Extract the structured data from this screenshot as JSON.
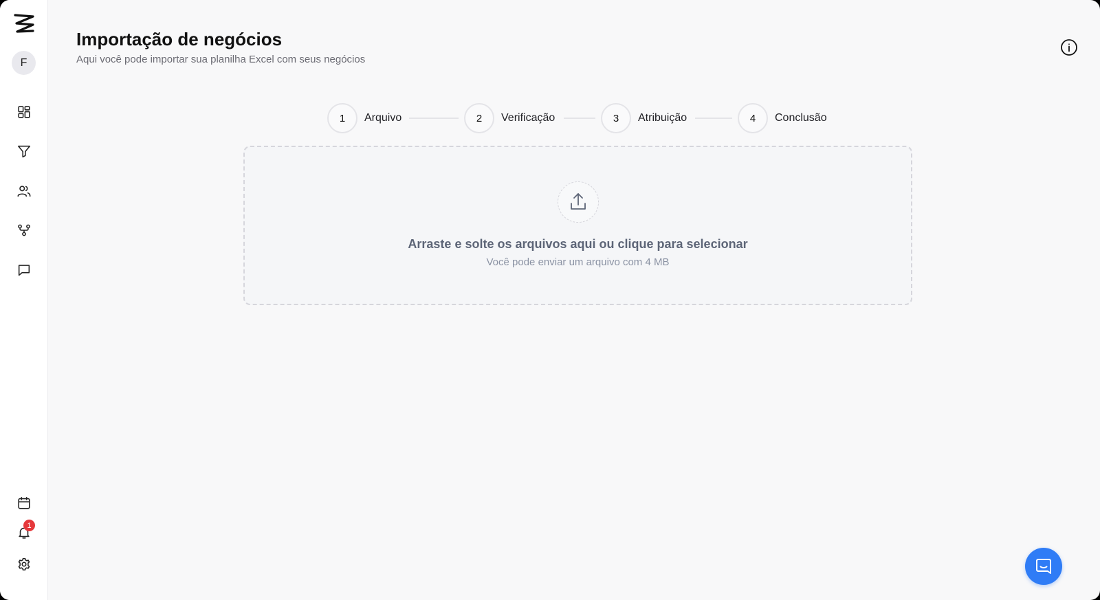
{
  "header": {
    "title": "Importação de negócios",
    "subtitle": "Aqui você pode importar sua planilha Excel com seus negócios"
  },
  "user": {
    "avatar_initial": "F"
  },
  "sidebar": {
    "items": [
      {
        "icon": "dashboard-icon"
      },
      {
        "icon": "filter-icon"
      },
      {
        "icon": "users-icon"
      },
      {
        "icon": "workflow-icon"
      },
      {
        "icon": "chat-icon"
      }
    ],
    "bottom": [
      {
        "icon": "calendar-icon"
      },
      {
        "icon": "bell-icon",
        "badge": "1"
      },
      {
        "icon": "gear-icon"
      }
    ]
  },
  "stepper": {
    "steps": [
      {
        "number": "1",
        "label": "Arquivo"
      },
      {
        "number": "2",
        "label": "Verificação"
      },
      {
        "number": "3",
        "label": "Atribuição"
      },
      {
        "number": "4",
        "label": "Conclusão"
      }
    ]
  },
  "dropzone": {
    "main_text": "Arraste e solte os arquivos aqui ou clique para selecionar",
    "sub_text": "Você pode enviar um arquivo com 4 MB"
  },
  "colors": {
    "accent": "#2f7cf6",
    "badge": "#e5383b",
    "background": "#f8f8f9"
  }
}
